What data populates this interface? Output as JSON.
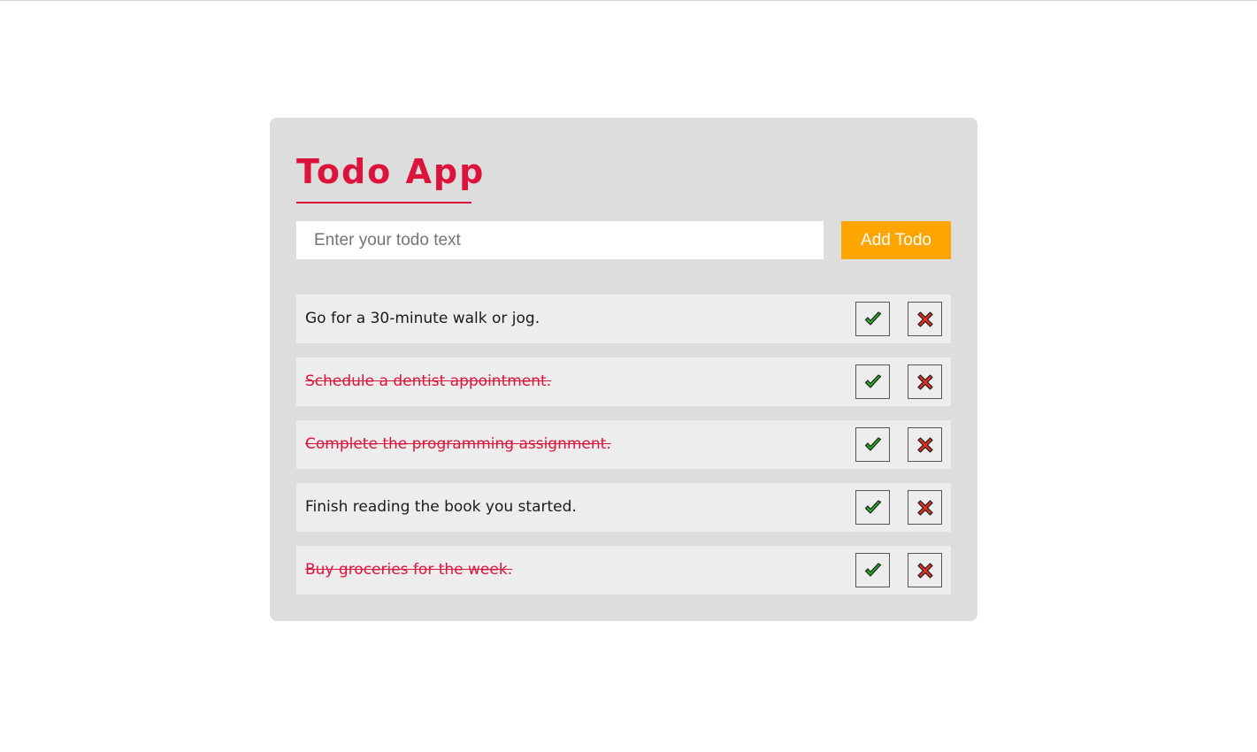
{
  "app": {
    "title": "Todo App"
  },
  "input": {
    "placeholder": "Enter your todo text",
    "value": ""
  },
  "add_button": {
    "label": "Add Todo"
  },
  "todos": [
    {
      "text": "Go for a 30-minute walk or jog.",
      "completed": false
    },
    {
      "text": "Schedule a dentist appointment.",
      "completed": true
    },
    {
      "text": "Complete the programming assignment.",
      "completed": true
    },
    {
      "text": "Finish reading the book you started.",
      "completed": false
    },
    {
      "text": "Buy groceries for the week.",
      "completed": true
    }
  ],
  "icons": {
    "complete": "check-icon",
    "delete": "close-icon"
  },
  "colors": {
    "accent": "#dc143c",
    "button": "#ffa500",
    "check": "#22b322",
    "delete": "#e0301e",
    "card": "#dddddd",
    "item": "#ededed"
  }
}
